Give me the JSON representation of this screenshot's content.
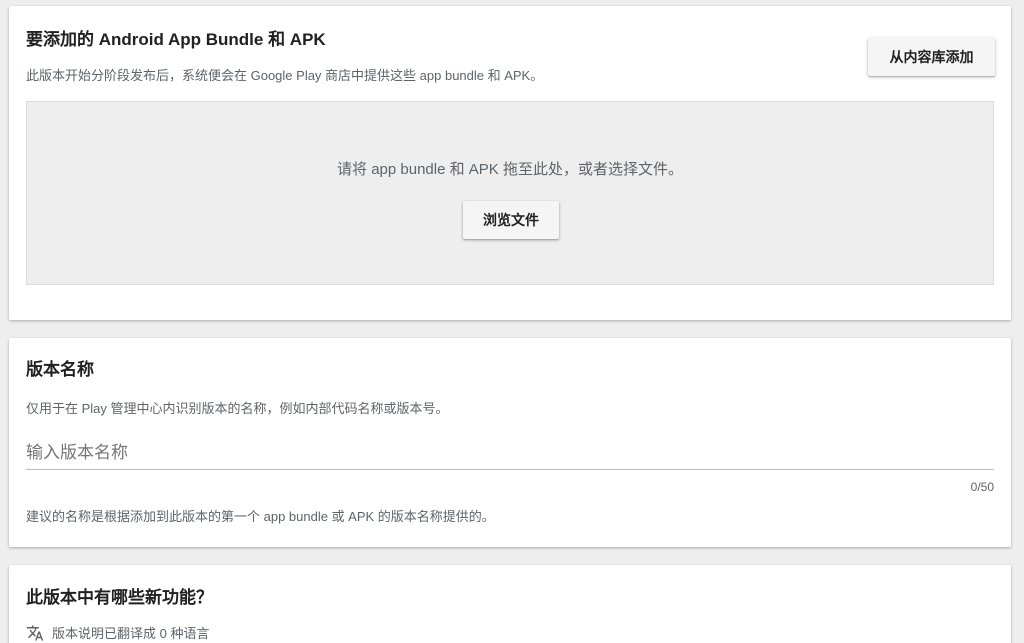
{
  "upload_section": {
    "title": "要添加的 Android App Bundle 和 APK",
    "description": "此版本开始分阶段发布后，系统便会在 Google Play 商店中提供这些 app bundle 和 APK。",
    "library_button": "从内容库添加",
    "dropzone_text": "请将 app bundle 和 APK 拖至此处，或者选择文件。",
    "browse_button": "浏览文件"
  },
  "release_name_section": {
    "title": "版本名称",
    "description": "仅用于在 Play 管理中心内识别版本的名称，例如内部代码名称或版本号。",
    "input_placeholder": "输入版本名称",
    "input_value": "",
    "counter": "0/50",
    "hint": "建议的名称是根据添加到此版本的第一个 app bundle 或 APK 的版本名称提供的。"
  },
  "release_notes_section": {
    "title": "此版本中有哪些新功能？",
    "translate_icon": "translate-icon",
    "translation_status": "版本说明已翻译成 0 种语言"
  }
}
